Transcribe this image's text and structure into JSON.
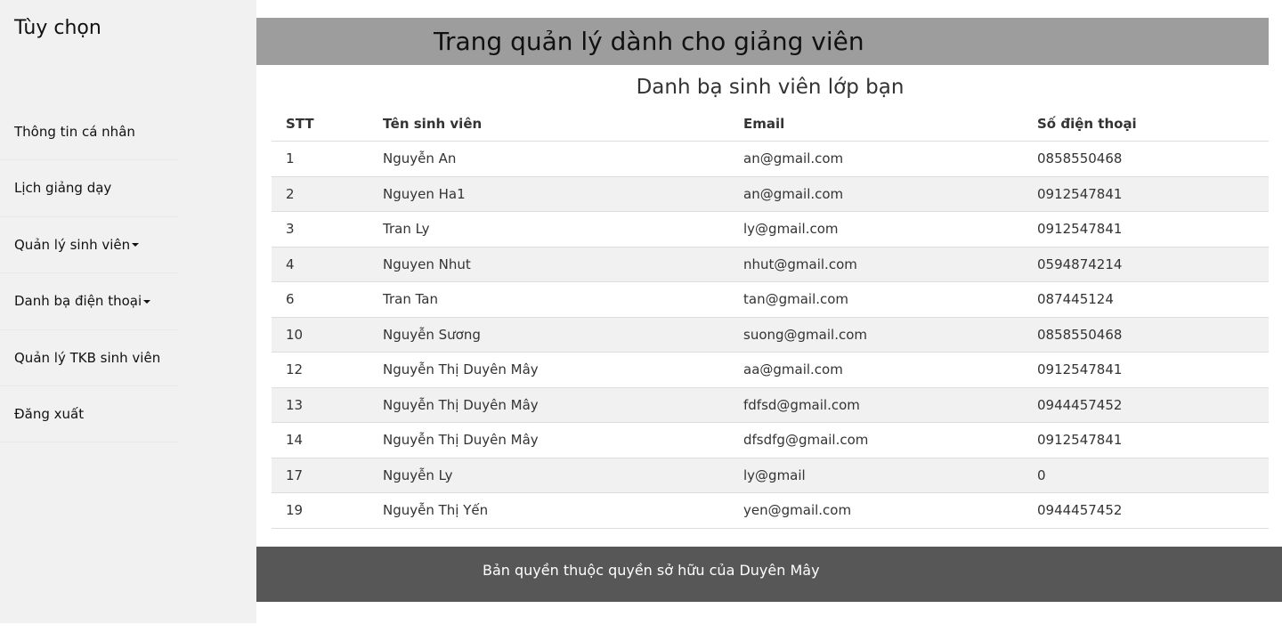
{
  "sidebar": {
    "title": "Tùy chọn",
    "items": [
      {
        "label": "Thông tin cá nhân"
      },
      {
        "label": "Lịch giảng dạy"
      },
      {
        "label": "Quản lý sinh viên"
      },
      {
        "label": "Danh bạ điện thoại"
      },
      {
        "label": "Quản lý TKB sinh viên"
      },
      {
        "label": "Đăng xuất"
      }
    ]
  },
  "header": {
    "title": "Trang quản lý dành cho giảng viên"
  },
  "main": {
    "subtitle": "Danh bạ sinh viên lớp bạn",
    "table": {
      "headers": [
        "STT",
        "Tên sinh viên",
        "Email",
        "Số điện thoại"
      ],
      "rows": [
        [
          "1",
          "Nguyễn An",
          "an@gmail.com",
          "0858550468"
        ],
        [
          "2",
          "Nguyen Ha1",
          "an@gmail.com",
          "0912547841"
        ],
        [
          "3",
          "Tran Ly",
          "ly@gmail.com",
          "0912547841"
        ],
        [
          "4",
          "Nguyen Nhut",
          "nhut@gmail.com",
          "0594874214"
        ],
        [
          "6",
          "Tran Tan",
          "tan@gmail.com",
          "087445124"
        ],
        [
          "10",
          "Nguyễn Sương",
          "suong@gmail.com",
          "0858550468"
        ],
        [
          "12",
          "Nguyễn Thị Duyên Mây",
          "aa@gmail.com",
          "0912547841"
        ],
        [
          "13",
          "Nguyễn Thị Duyên Mây",
          "fdfsd@gmail.com",
          "0944457452"
        ],
        [
          "14",
          "Nguyễn Thị Duyên Mây",
          "dfsdfg@gmail.com",
          "0912547841"
        ],
        [
          "17",
          "Nguyễn Ly",
          "ly@gmail",
          "0"
        ],
        [
          "19",
          "Nguyễn Thị Yến",
          "yen@gmail.com",
          "0944457452"
        ]
      ]
    }
  },
  "footer": {
    "text": "Bản quyền thuộc quyền sở hữu của Duyên Mây"
  },
  "colors": {
    "sidebar_bg": "#f1f1f1",
    "header_bg": "#9d9d9d",
    "footer_bg": "#575757",
    "stripe_bg": "#f1f1f1"
  }
}
